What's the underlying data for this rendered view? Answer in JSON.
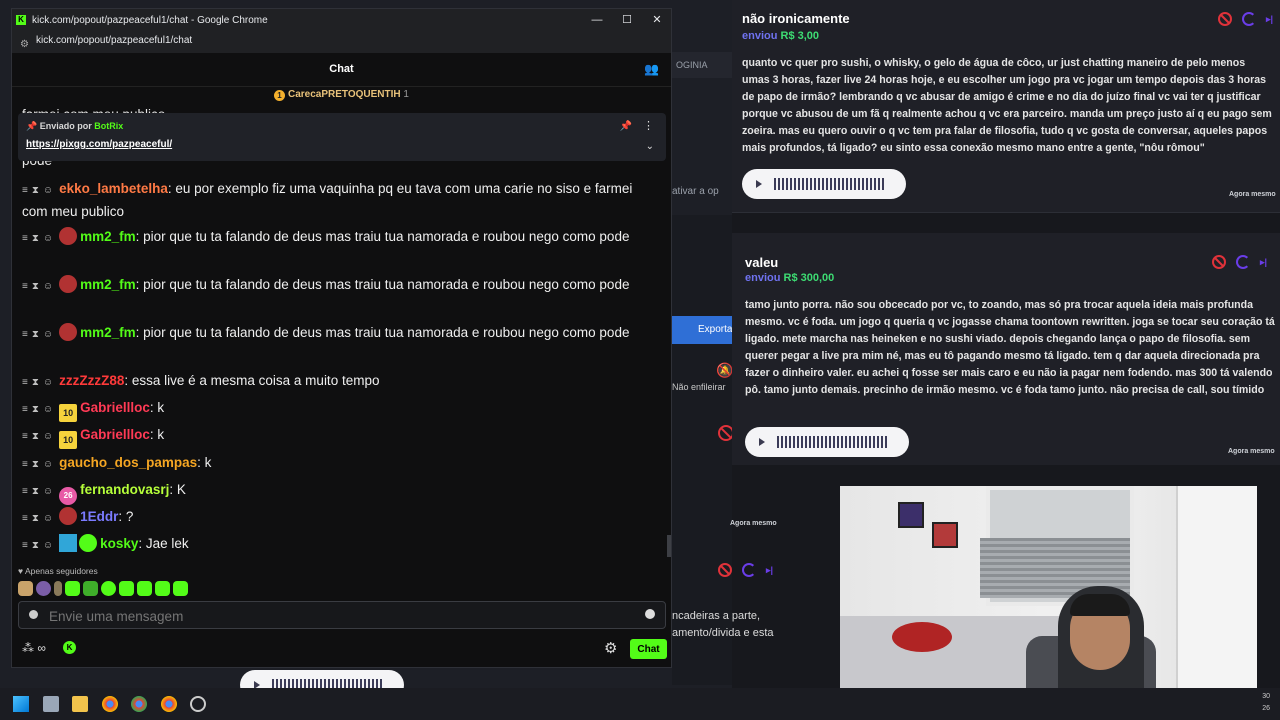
{
  "window": {
    "title": "kick.com/popout/pazpeaceful1/chat - Google Chrome",
    "url": "kick.com/popout/pazpeaceful1/chat"
  },
  "chat": {
    "header": "Chat",
    "top_user": {
      "name": "CarecaPRETOQUENTIH",
      "count": "1"
    },
    "cutoff_top": "farmei com meu publico",
    "cutoff_below": "pode",
    "pinned": {
      "sent_by_label": "Enviado por",
      "bot_name": "BotRix",
      "link": "https://pixgg.com/pazpeaceful/"
    },
    "messages": [
      {
        "user": "ekko_lambetelha",
        "color": "#ff7a45",
        "text": "eu por exemplo fiz uma vaquinha pq eu tava com uma carie no siso e farmei com meu publico"
      },
      {
        "user": "mm2_fm",
        "color": "#53fc18",
        "text": "pior que tu ta falando de deus mas traiu tua namorada e roubou nego como pode"
      },
      {
        "user": "mm2_fm",
        "color": "#53fc18",
        "text": "pior que tu ta falando de deus mas traiu tua namorada e roubou nego como pode"
      },
      {
        "user": "mm2_fm",
        "color": "#53fc18",
        "text": "pior que tu ta falando de deus mas traiu tua namorada e roubou nego como pode"
      },
      {
        "user": "zzzZzzZ88",
        "color": "#ff3a3a",
        "text": "essa live é a mesma coisa a muito tempo"
      },
      {
        "user": "Gabriellloc",
        "color": "#ff3a55",
        "text": "k",
        "sub": "10"
      },
      {
        "user": "Gabriellloc",
        "color": "#ff3a55",
        "text": "k",
        "sub": "10"
      },
      {
        "user": "gaucho_dos_pampas",
        "color": "#f5a623",
        "text": "k"
      },
      {
        "user": "fernandovasrj",
        "color": "#b6ff3a",
        "text": "K",
        "sub": "26"
      },
      {
        "user": "1Eddr",
        "color": "#7b7bff",
        "text": "?"
      },
      {
        "user": "kosky",
        "color": "#53fc18",
        "text": "Jae lek"
      }
    ],
    "followers_only": "Apenas seguidores",
    "input_placeholder": "Envie uma mensagem",
    "infinity": "∞",
    "send_label": "Chat"
  },
  "donations": [
    {
      "name": "não ironicamente",
      "sent": "enviou",
      "amount": "R$ 3,00",
      "text": "quanto vc quer pro sushi, o whisky, o gelo de água de côco, ur just chatting maneiro de pelo menos umas 3 horas, fazer live 24 horas hoje, e eu escolher um jogo pra vc jogar um tempo depois das 3 horas de papo de irmão? lembrando q vc abusar de amigo é crime e no dia do juízo final vc vai ter q justificar porque vc abusou de um fã q realmente achou q vc era parceiro. manda um preço justo aí q eu pago sem zoeira. mas eu quero ouvir o q vc tem pra falar de filosofia, tudo q vc gosta de conversar, aqueles papos mais profundos, tá ligado? eu sinto essa conexão mesmo mano entre a gente, \"nôu rômou\"",
      "time": "Agora mesmo"
    },
    {
      "name": "valeu",
      "sent": "enviou",
      "amount": "R$ 300,00",
      "text": "tamo junto porra. não sou obcecado por vc, to zoando, mas só pra trocar aquela ideia mais profunda mesmo. vc é foda. um jogo q queria q vc jogasse chama toontown rewritten. joga se tocar seu coração tá ligado. mete marcha nas heineken e no sushi viado. depois chegando lança o papo de filosofia. sem querer pegar a live pra mim né, mas eu tô pagando mesmo tá ligado. tem q dar aquela direcionada pra fazer o dinheiro valer. eu achei q fosse ser mais caro e eu não ia pagar nem fodendo. mas 300 tá valendo pô. tamo junto demais. precinho de irmão mesmo. vc é foda tamo junto. não precisa de call, sou tímido",
      "time": "Agora mesmo"
    }
  ],
  "background": {
    "strip_text": "OGINIA",
    "ativar": "ativar a op",
    "exporta": "Exporta",
    "nao_enfileirar": "Não enfileirar",
    "agora": "Agora mesmo",
    "fragment": "ncadeiras a parte, amento/divida e esta",
    "clock_time": "30",
    "clock_date": "26"
  }
}
